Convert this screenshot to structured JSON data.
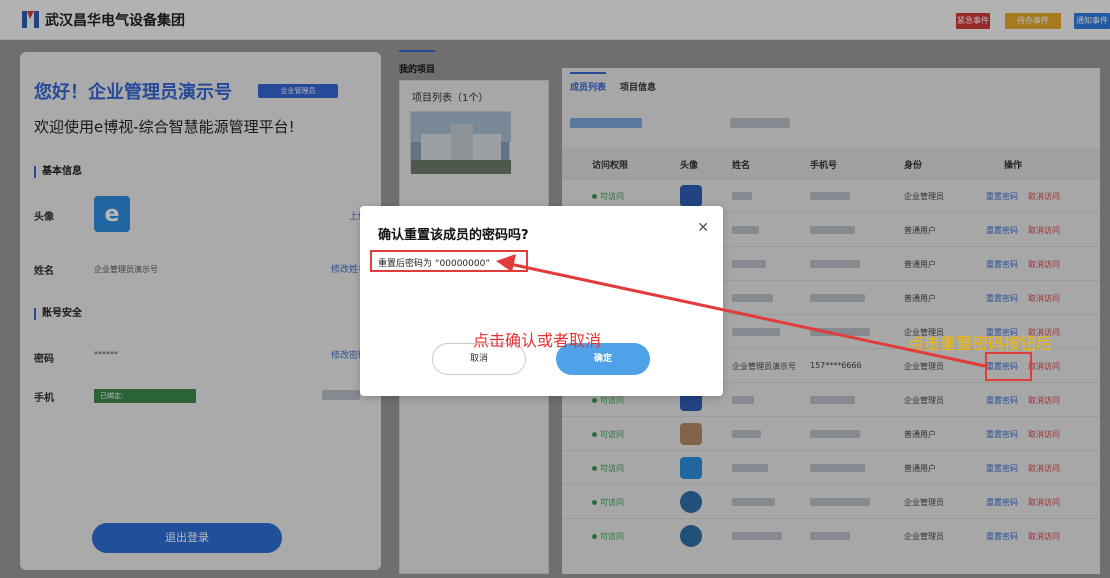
{
  "header": {
    "company": "武汉昌华电气设备集团",
    "buttons": [
      {
        "label": "紧急事件",
        "color": "#d33a3a"
      },
      {
        "label": "待办事件",
        "color": "#e8a92c"
      },
      {
        "label": "通知事件",
        "color": "#2f7de1"
      }
    ]
  },
  "profile": {
    "greeting": "您好！企业管理员演示号",
    "role_badge": "企业管理员",
    "welcome": "欢迎使用e博视-综合智慧能源管理平台!",
    "basic_section": "基本信息",
    "avatar_label": "头像",
    "upload": "上传",
    "name_label": "姓名",
    "name_value": "企业管理员演示号",
    "edit_name": "修改姓名",
    "security_section": "账号安全",
    "password_label": "密码",
    "password_value": "******",
    "edit_password": "修改密码",
    "phone_label": "手机",
    "phone_value": "已绑定:",
    "logout": "退出登录"
  },
  "projects": {
    "title": "我的项目",
    "list_label": "项目列表（1个）"
  },
  "members": {
    "tabs": [
      "成员列表",
      "项目信息"
    ],
    "columns": [
      "访问权限",
      "头像",
      "姓名",
      "手机号",
      "身份",
      "操作"
    ],
    "rows": [
      {
        "access": "可访问",
        "name": "",
        "phone": "",
        "role": "企业管理员",
        "icon": "company-logo"
      },
      {
        "access": "可访问",
        "name": "",
        "phone": "",
        "role": "普通用户",
        "icon": "none"
      },
      {
        "access": "可访问",
        "name": "",
        "phone": "",
        "role": "普通用户",
        "icon": "none"
      },
      {
        "access": "可访问",
        "name": "",
        "phone": "",
        "role": "普通用户",
        "icon": "none"
      },
      {
        "access": "可访问",
        "name": "",
        "phone": "",
        "role": "企业管理员",
        "icon": "none"
      },
      {
        "access": "可访问",
        "name": "企业管理员演示号",
        "phone": "157****6666",
        "role": "企业管理员",
        "icon": "none"
      },
      {
        "access": "可访问",
        "name": "",
        "phone": "",
        "role": "企业管理员",
        "icon": "company-logo"
      },
      {
        "access": "可访问",
        "name": "",
        "phone": "",
        "role": "普通用户",
        "icon": "photo"
      },
      {
        "access": "可访问",
        "name": "",
        "phone": "",
        "role": "普通用户",
        "icon": "app-logo"
      },
      {
        "access": "可访问",
        "name": "",
        "phone": "",
        "role": "企业管理员",
        "icon": "globe"
      },
      {
        "access": "可访问",
        "name": "",
        "phone": "",
        "role": "企业管理员",
        "icon": "globe"
      }
    ],
    "reset_label": "重置密码",
    "revoke_label": "取消访问"
  },
  "dialog": {
    "title": "确认重置该成员的密码吗?",
    "message": "重置后密码为 “00000000”",
    "cancel": "取消",
    "confirm": "确定"
  },
  "annotations": {
    "click_confirm": "点击确认或者取消",
    "after_reset": "点击重置密码按钮后"
  }
}
